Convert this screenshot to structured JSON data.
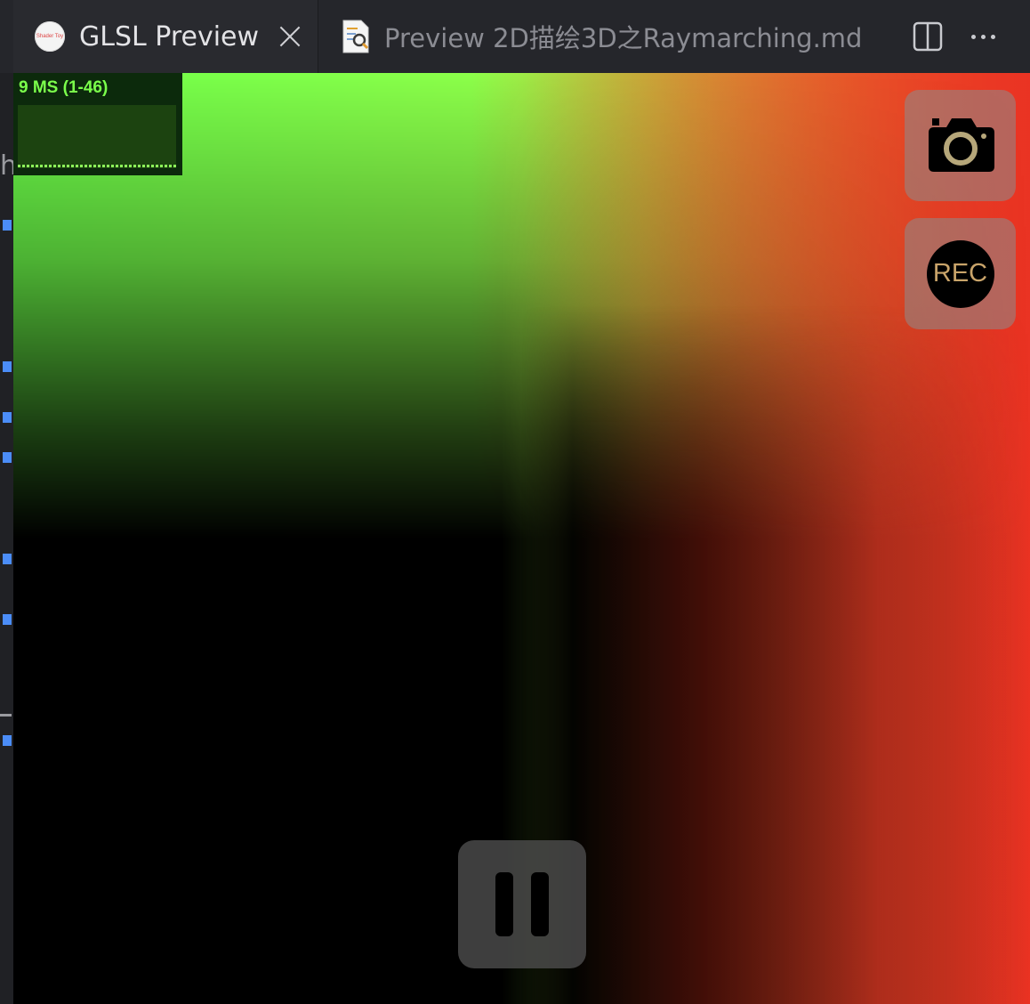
{
  "tabs": [
    {
      "label": "GLSL Preview",
      "icon": "shadertoy-icon",
      "active": true,
      "icon_text": "Shader Toy"
    },
    {
      "label": "Preview 2D描绘3D之Raymarching.md",
      "icon": "markdown-preview-icon",
      "active": false
    }
  ],
  "toolbar": {
    "split_icon": "split-editor-icon",
    "more_icon": "more-actions-icon"
  },
  "stats": {
    "label": "9 MS (1-46)"
  },
  "controls": {
    "screenshot_icon": "camera-icon",
    "record_label": "REC",
    "pause_icon": "pause-icon"
  },
  "gutter": {
    "partial_text": "h"
  },
  "colors": {
    "green": "#6dff4a",
    "yellow": "#f5ff4a",
    "red": "#ea3323",
    "black": "#000000"
  }
}
